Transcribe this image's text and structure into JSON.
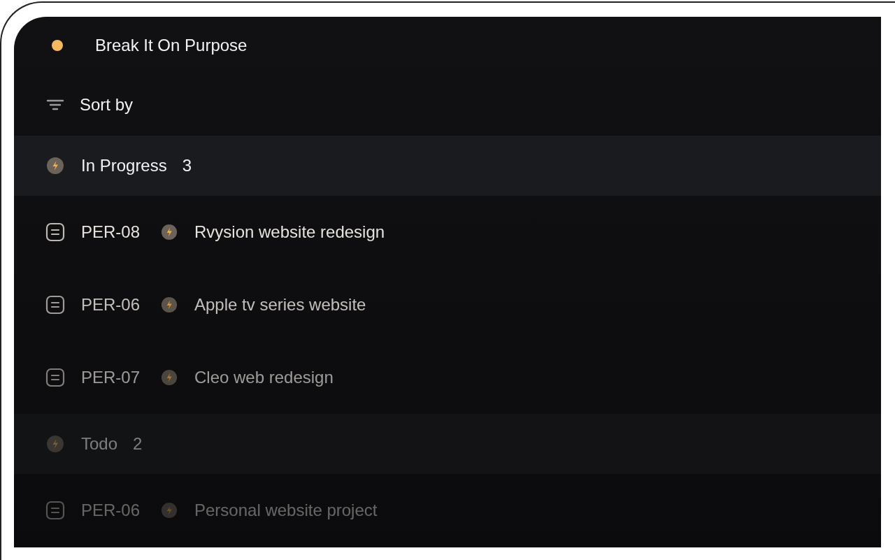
{
  "project": {
    "title": "Break It On Purpose",
    "color": "#f5b860"
  },
  "sort": {
    "label": "Sort by"
  },
  "rows": [
    {
      "kind": "group",
      "label": "In Progress",
      "count": "3"
    },
    {
      "kind": "issue",
      "id": "PER-08",
      "title": "Rvysion website redesign"
    },
    {
      "kind": "issue",
      "id": "PER-06",
      "title": "Apple tv series website"
    },
    {
      "kind": "issue",
      "id": "PER-07",
      "title": "Cleo web redesign"
    },
    {
      "kind": "group",
      "label": "Todo",
      "count": "2"
    },
    {
      "kind": "issue",
      "id": "PER-06",
      "title": "Personal website project"
    }
  ]
}
